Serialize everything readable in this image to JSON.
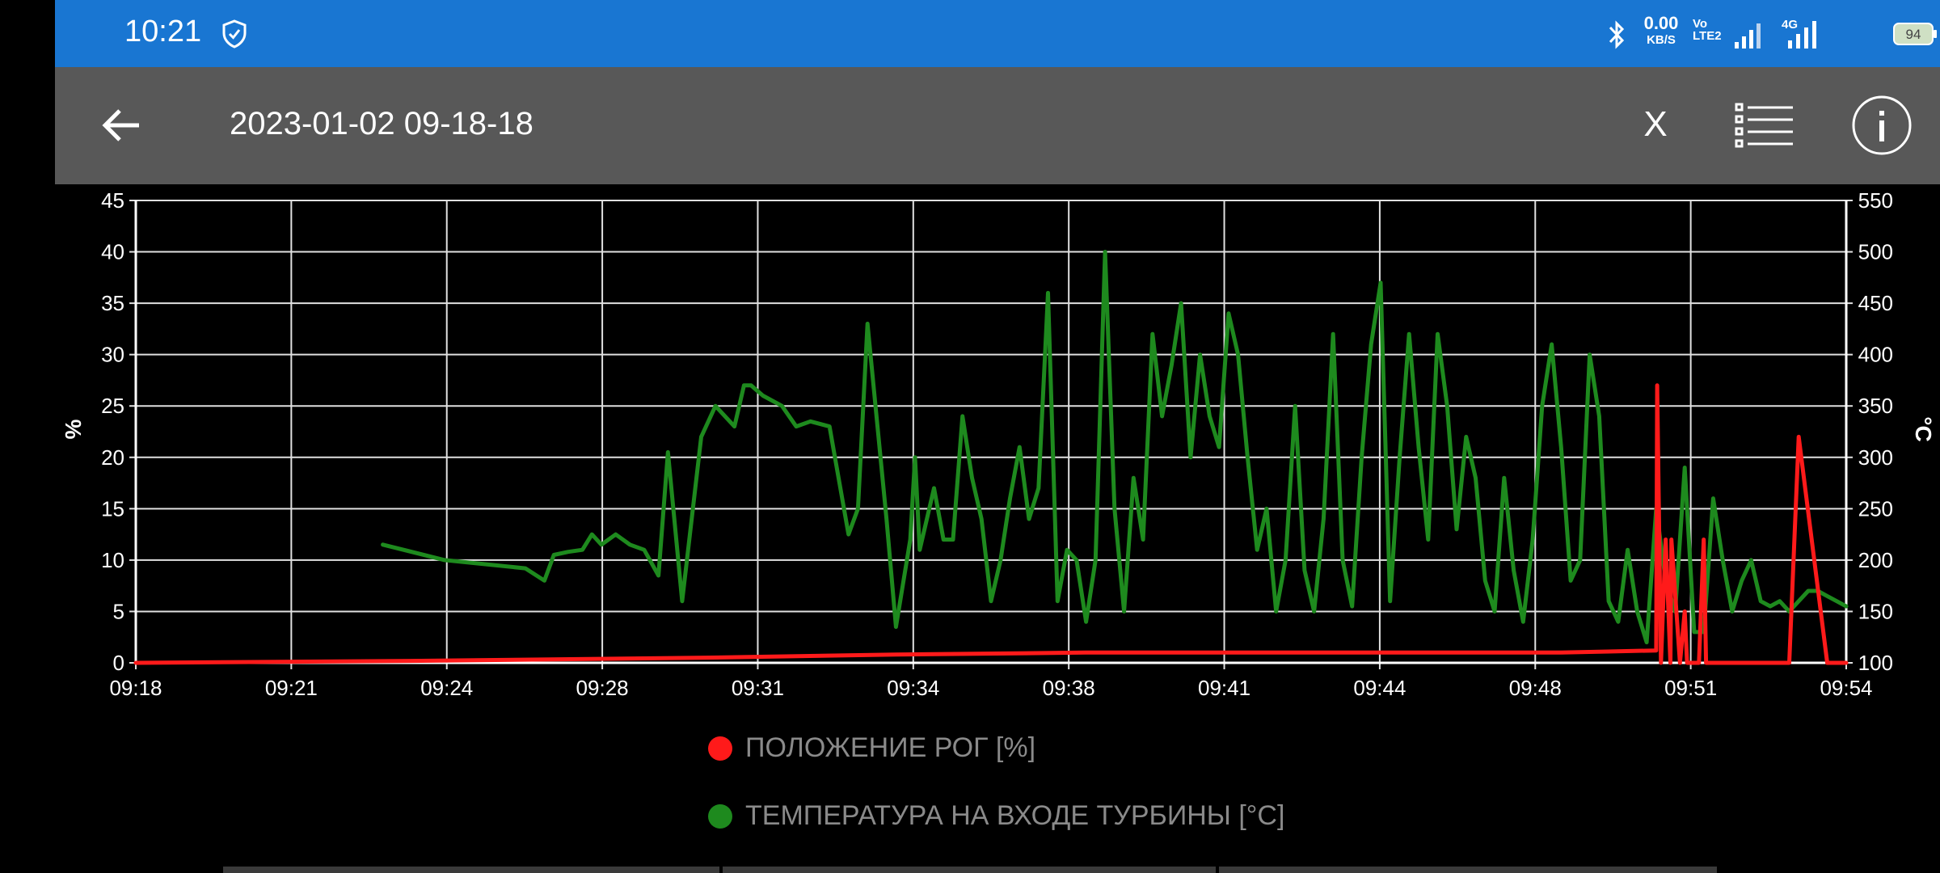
{
  "status_bar": {
    "time": "10:21",
    "shield_icon": "shield-check-icon",
    "bluetooth_icon": "bluetooth-icon",
    "net_speed_value": "0.00",
    "net_speed_unit": "KB/S",
    "volte_line1": "Vo",
    "volte_line2": "LTE2",
    "network_type": "4G",
    "battery": "94"
  },
  "app_bar": {
    "back_icon": "arrow-back-icon",
    "title": "2023-01-02 09-18-18",
    "close_label": "X",
    "list_icon": "list-icon",
    "info_icon": "info-icon"
  },
  "chart_data": {
    "type": "line",
    "x_ticks": [
      "09:18",
      "09:21",
      "09:24",
      "09:28",
      "09:31",
      "09:34",
      "09:38",
      "09:41",
      "09:44",
      "09:48",
      "09:51",
      "09:54"
    ],
    "x_range_minutes": [
      0,
      36
    ],
    "y_left": {
      "label": "%",
      "ticks": [
        0,
        5,
        10,
        15,
        20,
        25,
        30,
        35,
        40,
        45
      ],
      "range": [
        0,
        45
      ]
    },
    "y_right": {
      "label": "°C",
      "ticks": [
        100,
        150,
        200,
        250,
        300,
        350,
        400,
        450,
        500,
        550
      ],
      "range": [
        100,
        550
      ]
    },
    "grid": true,
    "legend_position": "bottom",
    "colors": {
      "red": "#ff1a1a",
      "green": "#1e8a1e",
      "grid": "#e0e0e0",
      "axis_text": "#ffffff",
      "legend_text": "#8a8a8a"
    },
    "series": [
      {
        "name": "ПОЛОЖЕНИЕ РОГ [%]",
        "axis": "left",
        "color": "#ff1a1a",
        "x": [
          0,
          6,
          12,
          16,
          20,
          24,
          27,
          30,
          31,
          32,
          32.02,
          32.1,
          32.2,
          32.3,
          32.32,
          32.5,
          32.6,
          32.65,
          32.9,
          33.0,
          33.05,
          33.2,
          33.3,
          33.35,
          33.7,
          34.0,
          34.8,
          35.0,
          35.6,
          36
        ],
        "y": [
          0,
          0.2,
          0.5,
          0.8,
          1,
          1,
          1,
          1,
          1.1,
          1.2,
          27,
          0,
          12,
          0,
          12,
          0,
          5,
          0,
          0,
          12,
          0,
          0,
          0,
          0,
          0,
          0,
          0,
          22,
          0,
          0
        ]
      },
      {
        "name": "ТЕМПЕРАТУРА НА ВХОДЕ ТУРБИНЫ [°C]",
        "axis": "right",
        "color": "#1e8a1e",
        "x": [
          5.2,
          6.5,
          8.2,
          8.6,
          8.8,
          9.1,
          9.4,
          9.6,
          9.8,
          10.1,
          10.4,
          10.7,
          11.0,
          11.2,
          11.5,
          11.6,
          11.9,
          12.2,
          12.6,
          12.8,
          12.95,
          13.2,
          13.6,
          13.9,
          14.2,
          14.6,
          15.0,
          15.2,
          15.4,
          15.8,
          16.0,
          16.3,
          16.4,
          16.5,
          16.8,
          17.0,
          17.2,
          17.4,
          17.6,
          17.8,
          18.0,
          18.2,
          18.4,
          18.6,
          18.8,
          19.0,
          19.2,
          19.4,
          19.6,
          19.8,
          20.0,
          20.2,
          20.4,
          20.6,
          20.8,
          21.0,
          21.2,
          21.4,
          21.6,
          21.8,
          22.0,
          22.2,
          22.4,
          22.6,
          22.8,
          23.0,
          23.2,
          23.4,
          23.6,
          23.8,
          24.0,
          24.2,
          24.4,
          24.6,
          24.8,
          25.0,
          25.2,
          25.4,
          25.6,
          25.8,
          26.0,
          26.2,
          26.4,
          26.6,
          26.8,
          27.0,
          27.2,
          27.4,
          27.6,
          27.8,
          28.0,
          28.2,
          28.4,
          28.6,
          28.8,
          29.0,
          29.2,
          29.4,
          29.6,
          29.8,
          30.0,
          30.2,
          30.4,
          30.6,
          30.8,
          31.0,
          31.2,
          31.4,
          31.6,
          31.8,
          32.0,
          32.2,
          32.4,
          32.6,
          32.8,
          33.0,
          33.2,
          33.4,
          33.6,
          33.8,
          34.0,
          34.2,
          34.4,
          34.6,
          34.8,
          35.0,
          35.2,
          35.4,
          35.6,
          35.8,
          36.0
        ],
        "y": [
          215,
          200,
          192,
          180,
          205,
          208,
          210,
          225,
          215,
          225,
          215,
          210,
          185,
          305,
          160,
          200,
          320,
          350,
          330,
          370,
          370,
          360,
          350,
          330,
          335,
          330,
          225,
          250,
          430,
          240,
          135,
          220,
          300,
          210,
          270,
          220,
          220,
          340,
          280,
          240,
          160,
          200,
          260,
          310,
          240,
          270,
          460,
          160,
          210,
          200,
          140,
          200,
          500,
          250,
          150,
          280,
          220,
          420,
          340,
          390,
          450,
          300,
          400,
          340,
          310,
          440,
          400,
          300,
          210,
          250,
          150,
          200,
          350,
          190,
          150,
          240,
          420,
          200,
          155,
          300,
          410,
          470,
          160,
          300,
          420,
          310,
          220,
          420,
          350,
          230,
          320,
          280,
          180,
          150,
          280,
          190,
          140,
          220,
          350,
          410,
          310,
          180,
          200,
          400,
          340,
          160,
          140,
          210,
          150,
          120,
          250,
          180,
          150,
          290,
          130,
          130,
          260,
          200,
          150,
          180,
          200,
          160,
          155,
          160,
          150,
          160,
          170,
          170,
          165,
          160,
          155
        ]
      }
    ]
  },
  "legend": {
    "red_label": "ПОЛОЖЕНИЕ РОГ [%]",
    "green_label": "ТЕМПЕРАТУРА НА ВХОДЕ ТУРБИНЫ [°C]"
  }
}
